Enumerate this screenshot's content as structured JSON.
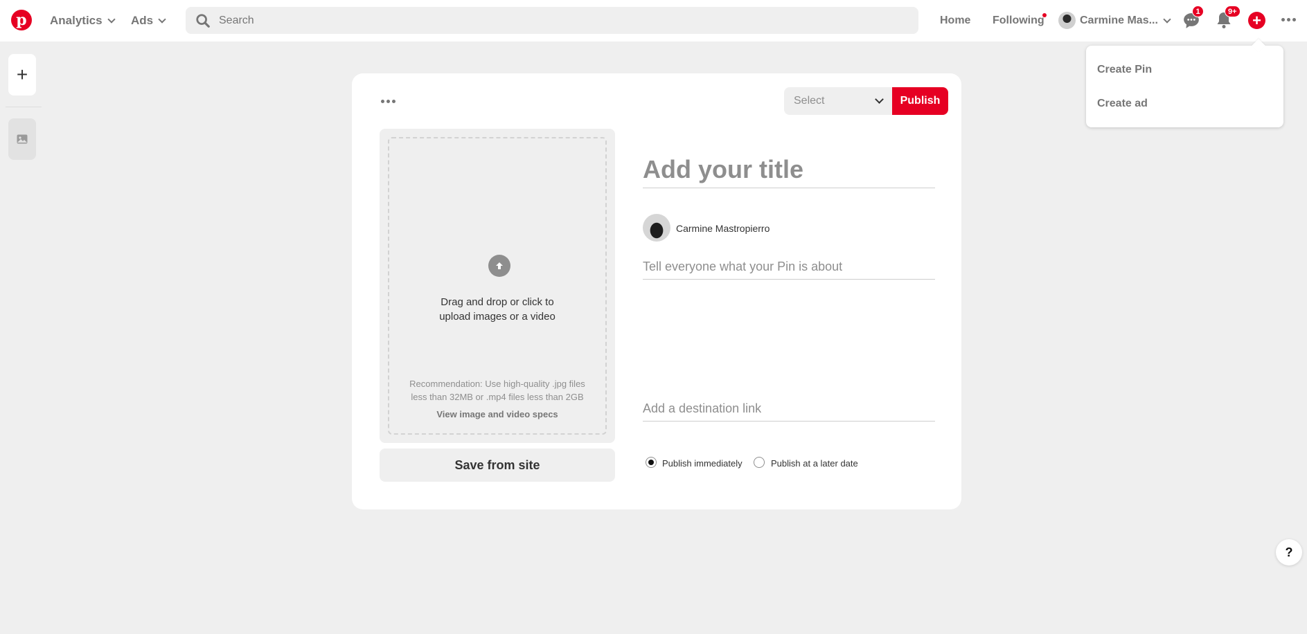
{
  "colors": {
    "brand": "#e60023",
    "background": "#efefef",
    "muted_text": "#767676"
  },
  "header": {
    "logo_icon": "pinterest-logo",
    "nav": [
      {
        "label": "Analytics",
        "icon": "chevron-down-icon"
      },
      {
        "label": "Ads",
        "icon": "chevron-down-icon"
      }
    ],
    "search": {
      "placeholder": "Search",
      "value": ""
    },
    "links": [
      {
        "label": "Home"
      },
      {
        "label": "Following",
        "has_notification_dot": true
      }
    ],
    "user": {
      "name": "Carmine Mas..."
    },
    "messages_badge": "1",
    "notifications_badge": "9+",
    "create_icon": "plus-icon",
    "more_icon": "ellipsis-icon"
  },
  "create_menu": {
    "items": [
      {
        "label": "Create Pin"
      },
      {
        "label": "Create ad"
      }
    ]
  },
  "left_rail": {
    "add_label": "+",
    "image_icon": "image-icon"
  },
  "pin_builder": {
    "board_select": {
      "placeholder": "Select"
    },
    "publish_label": "Publish",
    "upload": {
      "line1": "Drag and drop or click to",
      "line2": "upload images or a video",
      "rec_line1": "Recommendation: Use high-quality .jpg files",
      "rec_line2": "less than 32MB or .mp4 files less than 2GB",
      "specs_link": "View image and video specs"
    },
    "save_from_site_label": "Save from site",
    "title_placeholder": "Add your title",
    "author_name": "Carmine Mastropierro",
    "description_placeholder": "Tell everyone what your Pin is about",
    "link_placeholder": "Add a destination link",
    "publish_options": [
      {
        "label": "Publish immediately",
        "checked": true
      },
      {
        "label": "Publish at a later date",
        "checked": false
      }
    ]
  },
  "help_label": "?"
}
